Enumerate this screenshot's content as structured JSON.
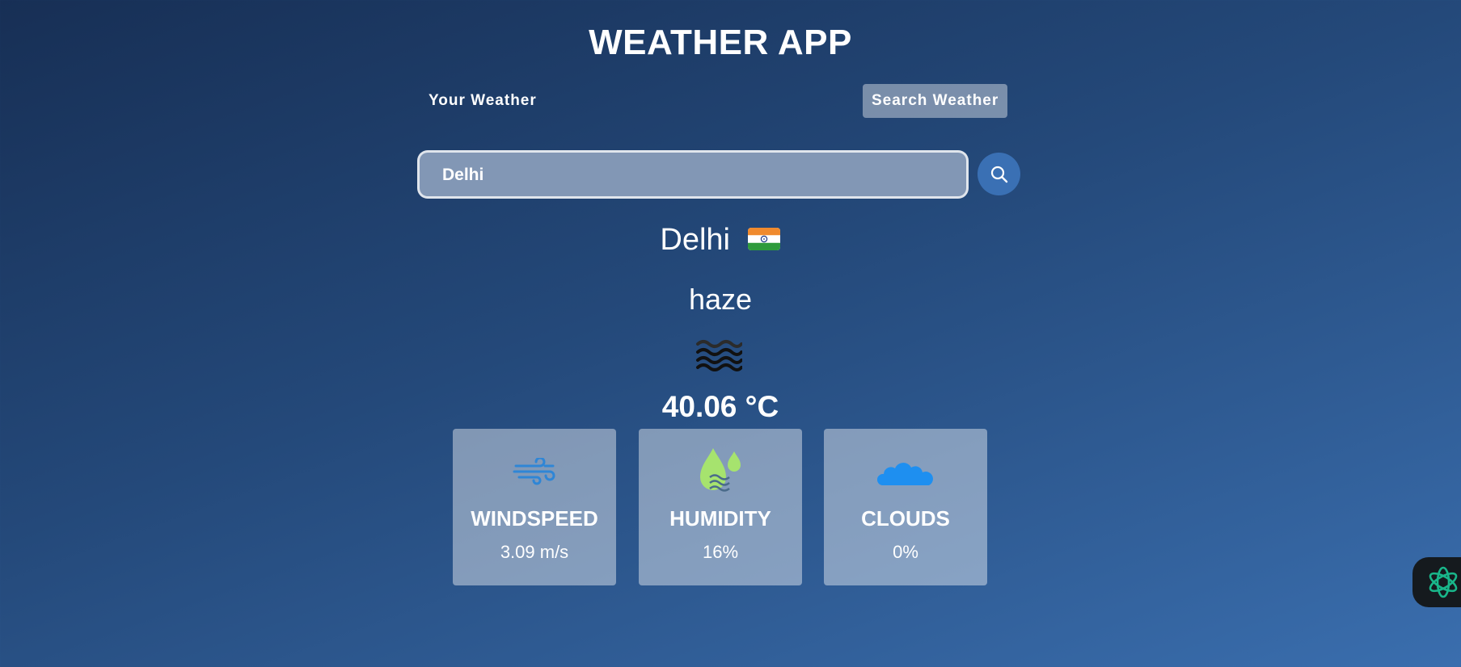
{
  "app": {
    "title": "WEATHER APP"
  },
  "tabs": {
    "your_weather": "Your Weather",
    "search_weather": "Search Weather"
  },
  "search": {
    "value": "Delhi",
    "button_icon": "search-icon"
  },
  "weather": {
    "city": "Delhi",
    "country_flag": "india-flag-icon",
    "condition": "haze",
    "condition_icon": "haze-icon",
    "temperature": "40.06 °C"
  },
  "stats": {
    "wind": {
      "label": "WINDSPEED",
      "value": "3.09 m/s",
      "icon": "wind-icon"
    },
    "humidity": {
      "label": "HUMIDITY",
      "value": "16%",
      "icon": "humidity-drops-icon"
    },
    "clouds": {
      "label": "CLOUDS",
      "value": "0%",
      "icon": "cloud-icon"
    }
  },
  "colors": {
    "background_top": "#172f55",
    "background_bottom": "#3a6eae",
    "accent_button": "#3a70b4",
    "card_bg": "rgba(255,255,255,0.42)",
    "wind_icon": "#2f86d6",
    "humidity_icon": "#a6e36e",
    "cloud_icon": "#1e8ff0"
  }
}
